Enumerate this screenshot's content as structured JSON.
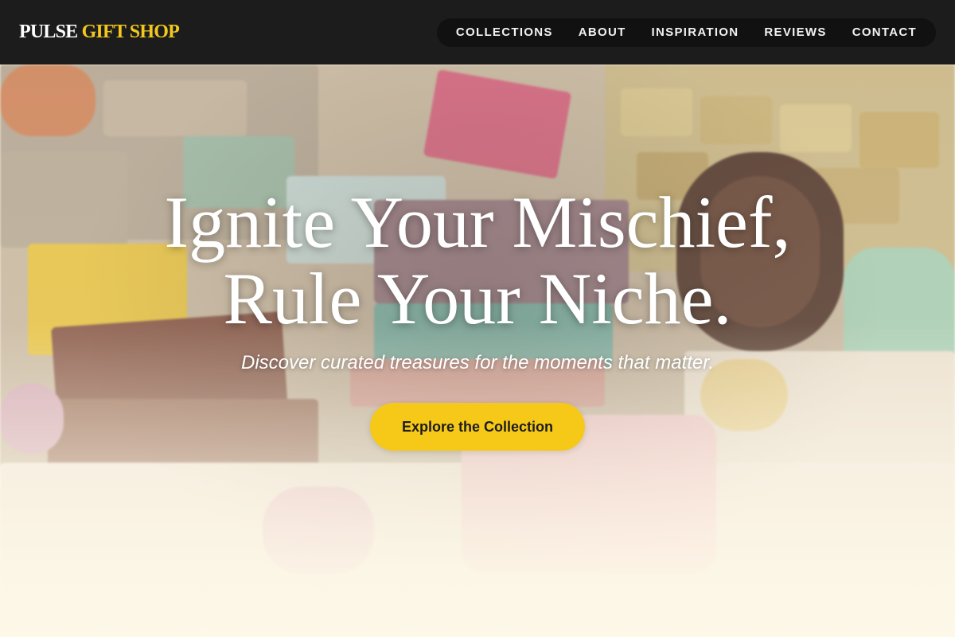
{
  "header": {
    "logo_primary": "PULSE",
    "logo_accent": "GIFT SHOP",
    "nav": [
      {
        "label": "COLLECTIONS"
      },
      {
        "label": "ABOUT"
      },
      {
        "label": "INSPIRATION"
      },
      {
        "label": "REVIEWS"
      },
      {
        "label": "CONTACT"
      }
    ]
  },
  "hero": {
    "headline_line1": "Ignite Your Mischief,",
    "headline_line2": "Rule Your Niche.",
    "subheadline": "Discover curated treasures for the moments that matter.",
    "cta_label": "Explore the Collection",
    "background_icon": "soap-gift-boxes-photo"
  },
  "colors": {
    "header_bg": "#1c1c1c",
    "accent": "#f2c81e",
    "cta_bg": "#f6c918",
    "text_light": "#ffffff"
  }
}
